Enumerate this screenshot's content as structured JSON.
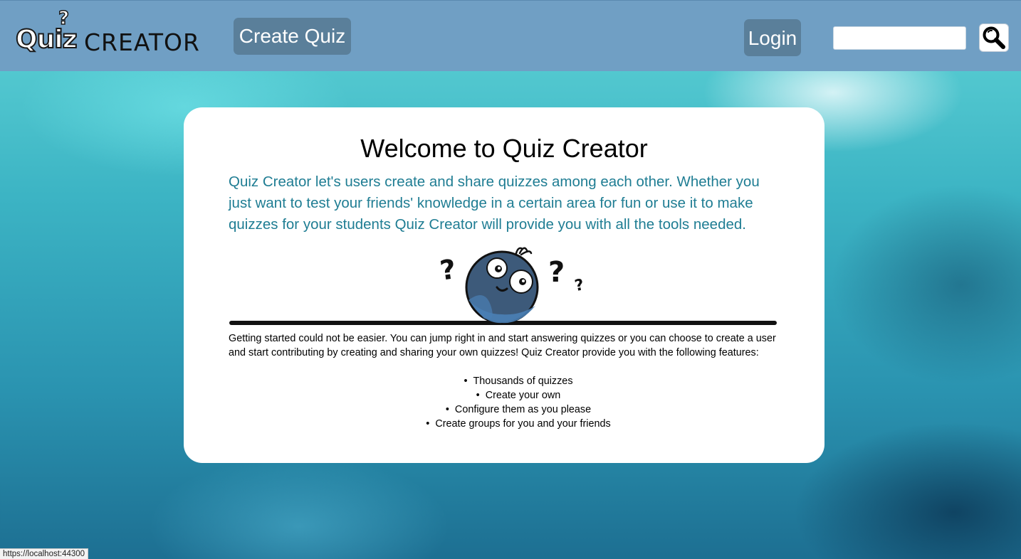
{
  "header": {
    "logo": {
      "word1": "Quiz",
      "mark": "?",
      "word2": "CREATOR"
    },
    "create_quiz_label": "Create Quiz",
    "login_label": "Login",
    "search": {
      "value": "",
      "placeholder": ""
    },
    "search_icon": "magnifier-icon"
  },
  "main": {
    "title": "Welcome to Quiz Creator",
    "intro": "Quiz Creator let's users create and share quizzes among each other. Whether you just want to test your friends' knowledge in a certain area for fun or use it to make quizzes for your students Quiz Creator will provide you with all the tools needed.",
    "body": "Getting started could not be easier. You can jump right in and start answering quizzes or you can choose to create a user and start contributing by creating and sharing your own quizzes! Quiz Creator provide you with the following features:",
    "features": [
      "Thousands of quizzes",
      "Create your own",
      "Configure them as you please",
      "Create groups for you and your friends"
    ]
  },
  "status_bar": {
    "url": "https://localhost:44300"
  },
  "colors": {
    "header_bg": "#709fc4",
    "nav_button_bg": "#5a7f9a",
    "intro_text": "#1f7d93",
    "card_bg": "#ffffff",
    "mascot_body": "#3d5a7a"
  }
}
